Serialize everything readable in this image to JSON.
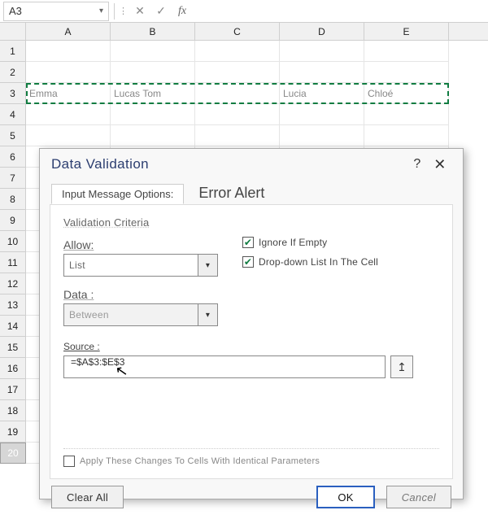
{
  "namebox": {
    "value": "A3"
  },
  "fb": {
    "fx": "fx"
  },
  "cols": [
    "A",
    "B",
    "C",
    "D",
    "E"
  ],
  "row3": {
    "a": "Emma",
    "b1": "Lucas",
    "b2": "Tom",
    "d": "Lucia",
    "e": "Chloé"
  },
  "rows_below": [
    "4",
    "5",
    "6",
    "7",
    "8",
    "9",
    "10",
    "11",
    "12",
    "13",
    "14",
    "15",
    "16",
    "17",
    "18",
    "19",
    "20"
  ],
  "dialog": {
    "title": "Data Validation",
    "tabs": {
      "settings": "Input Message Options:",
      "error": "Error Alert"
    },
    "criteria_label": "Validation Criteria",
    "allow_label": "Allow:",
    "allow_value": "List",
    "data_label": "Data :",
    "data_value": "Between",
    "chk_ignore": "Ignore If Empty",
    "chk_dropdown": "Drop-down List In The Cell",
    "source_label": "Source :",
    "source_value": "=$A$3:$E$3",
    "apply_label": "Apply These Changes To Cells With Identical Parameters",
    "btn_clear": "Clear All",
    "btn_ok": "OK",
    "btn_cancel": "Cancel"
  }
}
